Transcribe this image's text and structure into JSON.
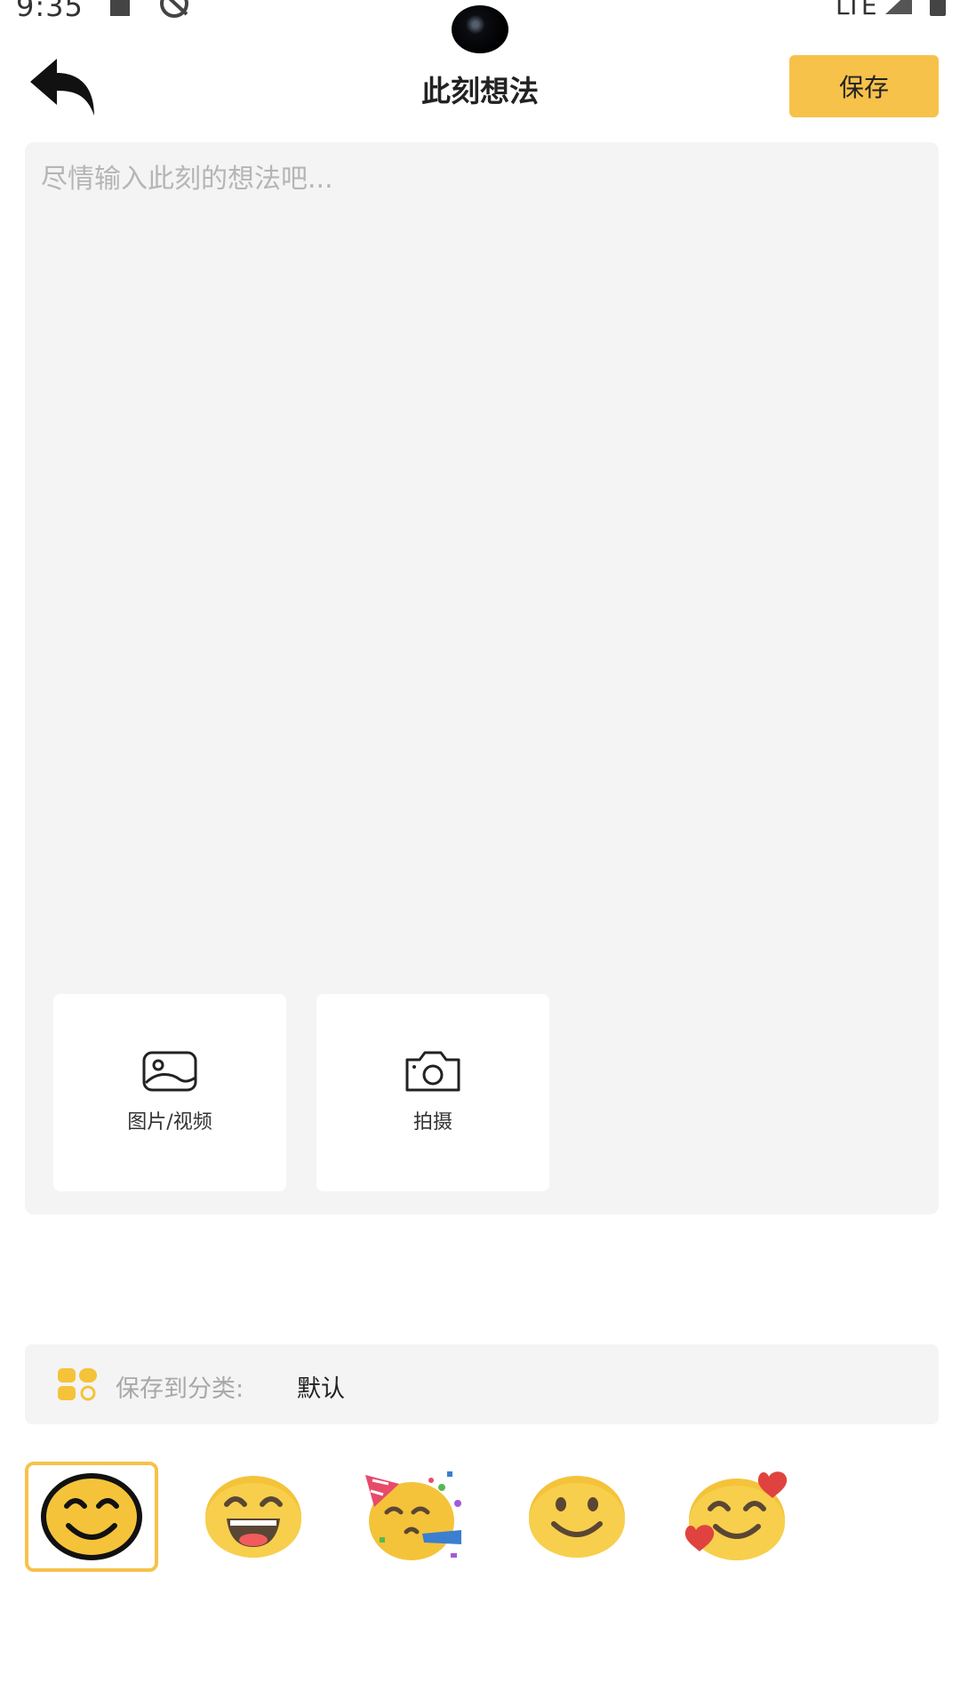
{
  "status_bar": {
    "time": "9:35",
    "network": "LTE"
  },
  "header": {
    "title": "此刻想法",
    "save_label": "保存"
  },
  "editor": {
    "placeholder": "尽情输入此刻的想法吧...",
    "value": ""
  },
  "media_buttons": [
    {
      "label": "图片/视频",
      "icon": "image-icon"
    },
    {
      "label": "拍摄",
      "icon": "camera-icon"
    }
  ],
  "category": {
    "label": "保存到分类:",
    "value": "默认"
  },
  "emojis": {
    "selected_index": 0,
    "items": [
      "smiling-face-icon",
      "grinning-face-icon",
      "party-face-icon",
      "slightly-smiling-face-icon",
      "smiling-face-with-hearts-icon"
    ]
  },
  "colors": {
    "accent": "#f7c24a",
    "editor_bg": "#f4f4f4",
    "emoji_yellow": "#f4c33a"
  }
}
